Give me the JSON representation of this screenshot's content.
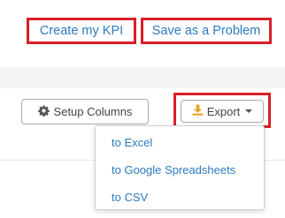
{
  "header_links": {
    "create_kpi": "Create my KPI",
    "save_problem": "Save as a Problem"
  },
  "toolbar": {
    "setup_columns": "Setup Columns",
    "export": "Export"
  },
  "export_menu": {
    "items": [
      "to Excel",
      "to Google Spreadsheets",
      "to CSV"
    ]
  },
  "icons": {
    "setup": "gear-icon",
    "export": "download-icon",
    "dropdown": "caret-down-icon"
  },
  "colors": {
    "link": "#2b7bc0",
    "highlight_border": "#d91e2a",
    "download_icon": "#e8a21a"
  }
}
